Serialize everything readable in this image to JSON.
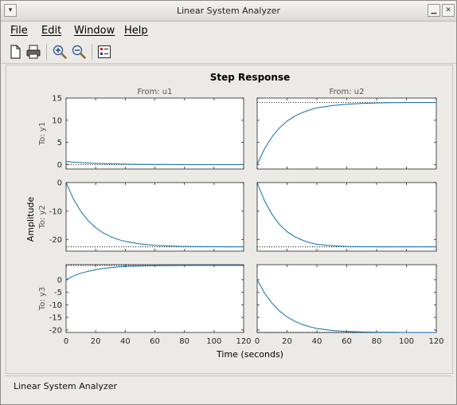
{
  "window": {
    "title": "Linear System Analyzer",
    "menu_icon": "window-menu-icon",
    "minimize_icon": "minimize-icon",
    "close_icon": "close-icon"
  },
  "menubar": {
    "items": [
      "File",
      "Edit",
      "Window",
      "Help"
    ]
  },
  "toolbar": {
    "icons": [
      "new-icon",
      "print-icon",
      "zoom-in-icon",
      "zoom-out-icon",
      "plot-config-icon"
    ]
  },
  "status": {
    "text": "Linear System Analyzer"
  },
  "colors": {
    "line": "#0a6fa8",
    "steady_state": "#000000"
  },
  "chart_data": {
    "type": "line",
    "title": "Step Response",
    "xlabel": "Time (seconds)",
    "ylabel": "Amplitude",
    "column_labels": [
      "From: u1",
      "From: u2"
    ],
    "row_labels": [
      "To: y1",
      "To: y2",
      "To: y3"
    ],
    "xlim": [
      0,
      120
    ],
    "xticks": [
      0,
      20,
      40,
      60,
      80,
      100,
      120
    ],
    "yaxes": [
      {
        "ylim": [
          -1,
          15
        ],
        "yticks": [
          0,
          5,
          10,
          15
        ]
      },
      {
        "ylim": [
          -24,
          0
        ],
        "yticks": [
          0,
          -10,
          -20
        ]
      },
      {
        "ylim": [
          -21,
          6
        ],
        "yticks": [
          0,
          -5,
          -10,
          -15,
          -20
        ]
      }
    ],
    "responses": [
      {
        "row": 0,
        "col": 0,
        "name": "From: u1 To: y1",
        "final": 0,
        "x": [
          0,
          5,
          10,
          15,
          20,
          25,
          30,
          35,
          40,
          50,
          60,
          70,
          80,
          90,
          100,
          110,
          120
        ],
        "y": [
          0.7,
          0.55,
          0.43,
          0.34,
          0.26,
          0.2,
          0.16,
          0.12,
          0.1,
          0.06,
          0.04,
          0.02,
          0.01,
          0.01,
          0,
          0,
          0
        ]
      },
      {
        "row": 0,
        "col": 1,
        "name": "From: u2 To: y1",
        "final": 14,
        "x": [
          0,
          5,
          10,
          15,
          20,
          25,
          30,
          35,
          40,
          50,
          60,
          70,
          80,
          90,
          100,
          110,
          120
        ],
        "y": [
          0,
          3.6,
          6.3,
          8.3,
          9.8,
          10.9,
          11.7,
          12.3,
          12.8,
          13.3,
          13.6,
          13.8,
          13.9,
          13.95,
          14,
          14,
          14
        ]
      },
      {
        "row": 1,
        "col": 0,
        "name": "From: u1 To: y2",
        "final": -22.5,
        "x": [
          0,
          5,
          10,
          15,
          20,
          25,
          30,
          35,
          40,
          50,
          60,
          70,
          80,
          90,
          100,
          110,
          120
        ],
        "y": [
          0,
          -5.8,
          -10.1,
          -13.4,
          -15.8,
          -17.6,
          -18.9,
          -19.9,
          -20.6,
          -21.5,
          -22,
          -22.2,
          -22.35,
          -22.4,
          -22.45,
          -22.5,
          -22.5
        ]
      },
      {
        "row": 1,
        "col": 1,
        "name": "From: u2 To: y2",
        "final": -22.5,
        "x": [
          0,
          5,
          10,
          15,
          20,
          25,
          30,
          35,
          40,
          50,
          60,
          70,
          80,
          90,
          100,
          110,
          120
        ],
        "y": [
          0,
          -6.5,
          -11.2,
          -14.7,
          -17.2,
          -18.9,
          -20.1,
          -21,
          -21.6,
          -22.1,
          -22.35,
          -22.45,
          -22.5,
          -22.5,
          -22.5,
          -22.5,
          -22.5
        ]
      },
      {
        "row": 2,
        "col": 0,
        "name": "From: u1 To: y3",
        "final": 5.7,
        "x": [
          0,
          5,
          10,
          15,
          20,
          25,
          30,
          35,
          40,
          50,
          60,
          70,
          80,
          90,
          100,
          110,
          120
        ],
        "y": [
          0,
          1.5,
          2.6,
          3.4,
          4,
          4.5,
          4.8,
          5.1,
          5.3,
          5.5,
          5.6,
          5.65,
          5.7,
          5.7,
          5.7,
          5.7,
          5.7
        ]
      },
      {
        "row": 2,
        "col": 1,
        "name": "From: u2 To: y3",
        "final": -21,
        "x": [
          0,
          5,
          10,
          15,
          20,
          25,
          30,
          35,
          40,
          50,
          60,
          70,
          80,
          90,
          100,
          110,
          120
        ],
        "y": [
          0,
          -5.4,
          -9.4,
          -12.5,
          -14.8,
          -16.5,
          -17.8,
          -18.7,
          -19.4,
          -20.2,
          -20.6,
          -20.8,
          -20.9,
          -20.95,
          -21,
          -21,
          -21
        ]
      }
    ]
  }
}
